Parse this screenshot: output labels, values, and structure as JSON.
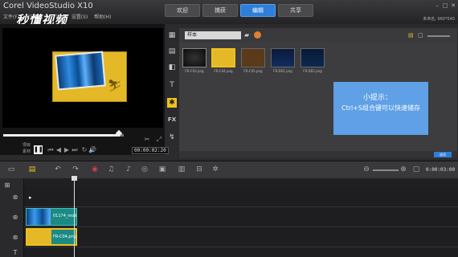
{
  "app": {
    "title": "Corel VideoStudio X10",
    "project_info": "未命名, 960*540"
  },
  "menu": [
    "文件(F)",
    "编辑(E)",
    "工具(T)",
    "设置(S)",
    "帮助(H)"
  ],
  "watermark": "秒懂视频",
  "tabs": [
    {
      "label": "欢迎",
      "active": false
    },
    {
      "label": "捕获",
      "active": false
    },
    {
      "label": "编辑",
      "active": true
    },
    {
      "label": "共享",
      "active": false
    }
  ],
  "player": {
    "mode_project": "项目",
    "mode_clip": "素材",
    "timecode": "00:00:02:20",
    "progress": 0.96
  },
  "library": {
    "folder": "样本",
    "thumbnails": [
      {
        "label": "FR-C03.png",
        "selected": false
      },
      {
        "label": "FR-C04.png",
        "selected": true
      },
      {
        "label": "FR-C05.png",
        "selected": false
      },
      {
        "label": "FR-D01.png",
        "selected": false
      },
      {
        "label": "FR-D02.png",
        "selected": false
      }
    ],
    "options_label": "选项"
  },
  "tip": {
    "title": "小提示：",
    "body": "Ctrl+S组合键可以快速储存"
  },
  "timeline": {
    "timecode": "0:00:03:00",
    "video_clip": "01174_moti",
    "overlay_clip": "FR-C04.png",
    "zoom": 0.5
  },
  "colors": {
    "accent": "#2f7ed8",
    "selected": "#f0c020",
    "clip": "#1b8a85",
    "tip": "#5fa0e6"
  }
}
